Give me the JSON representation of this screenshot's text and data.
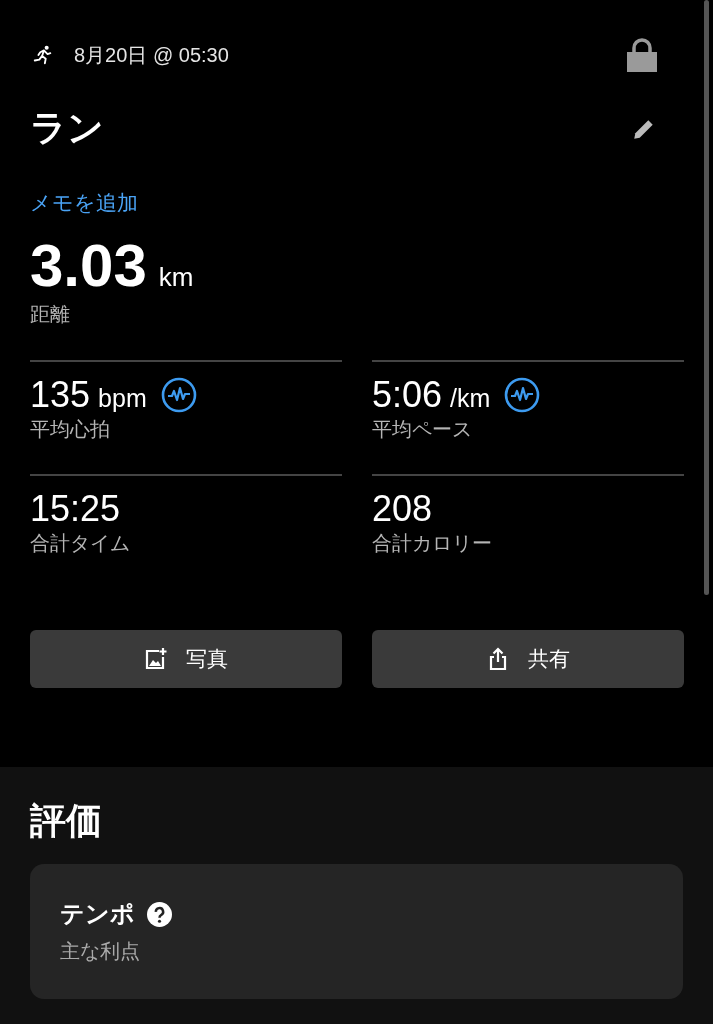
{
  "header": {
    "datetime": "8月20日 @ 05:30",
    "locked": true
  },
  "activity": {
    "title": "ラン",
    "add_note": "メモを追加"
  },
  "distance": {
    "value": "3.03",
    "unit": "km",
    "label": "距離"
  },
  "stats": [
    {
      "kind": "trend",
      "value": "135",
      "unit": "bpm",
      "label": "平均心拍"
    },
    {
      "kind": "trend",
      "value": "5:06",
      "unit": "/km",
      "label": "平均ペース"
    },
    {
      "kind": "plain",
      "value": "15:25",
      "label": "合計タイム"
    },
    {
      "kind": "plain",
      "value": "208",
      "label": "合計カロリー"
    }
  ],
  "buttons": [
    {
      "kind": "photo",
      "label": "写真"
    },
    {
      "kind": "share",
      "label": "共有"
    }
  ],
  "evaluation": {
    "heading": "評価",
    "card": {
      "title": "テンポ",
      "subtitle": "主な利点"
    }
  }
}
